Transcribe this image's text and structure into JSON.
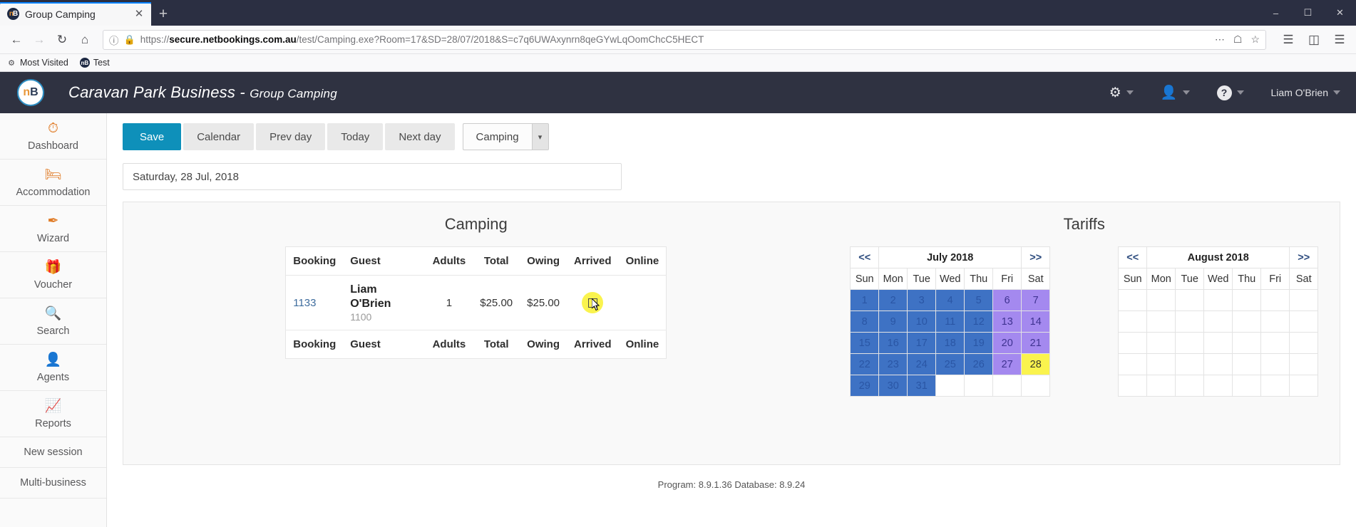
{
  "browser": {
    "tab": {
      "title": "Group Camping",
      "favicon_icon": "netbookings-favicon",
      "close_icon": "close-icon"
    },
    "newtab_icon": "plus-icon",
    "window_controls": {
      "minimize": "–",
      "maximize": "☐",
      "close": "✕"
    },
    "nav": {
      "back_icon": "back-arrow-icon",
      "forward_icon": "forward-arrow-icon",
      "reload_icon": "reload-icon",
      "home_icon": "home-icon",
      "info_icon": "page-info-icon",
      "lock_icon": "lock-icon",
      "url": "https://secure.netbookings.com.au/test/Camping.exe?Room=17&SD=28/07/2018&S=c7q6UWAxynrn8qeGYwLqOomChcC5HECT",
      "url_domain": "secure.netbookings.com.au",
      "url_prefix": "https://",
      "url_suffix": "/test/Camping.exe?Room=17&SD=28/07/2018&S=c7q6UWAxynrn8qeGYwLqOomChcC5HECT",
      "menu_icon": "ellipsis-icon",
      "pocket_icon": "pocket-icon",
      "star_icon": "bookmark-star-icon",
      "library_icon": "library-icon",
      "sidebar_icon": "sidebar-icon",
      "hamburger_icon": "hamburger-menu-icon"
    },
    "bookmarks": [
      {
        "label": "Most Visited",
        "icon": "most-visited-icon"
      },
      {
        "label": "Test",
        "icon": "netbookings-favicon"
      }
    ]
  },
  "header": {
    "logo_text": "nB",
    "title_main": "Caravan Park Business",
    "title_sep": " - ",
    "title_sub": "Group Camping",
    "settings_icon": "gears-icon",
    "user_icon": "person-icon",
    "help_icon": "question-mark-icon",
    "username": "Liam O'Brien"
  },
  "sidebar": {
    "items": [
      {
        "label": "Dashboard",
        "icon": "dashboard-gauge-icon",
        "glyph": "⏱"
      },
      {
        "label": "Accommodation",
        "icon": "bed-icon",
        "glyph": "🛏"
      },
      {
        "label": "Wizard",
        "icon": "magic-wand-icon",
        "glyph": "✒"
      },
      {
        "label": "Voucher",
        "icon": "gift-icon",
        "glyph": "🎁"
      },
      {
        "label": "Search",
        "icon": "magnifier-icon",
        "glyph": "🔍"
      },
      {
        "label": "Agents",
        "icon": "agent-person-icon",
        "glyph": "👤"
      },
      {
        "label": "Reports",
        "icon": "chart-up-icon",
        "glyph": "📈"
      }
    ],
    "plain_items": [
      {
        "label": "New session"
      },
      {
        "label": "Multi-business"
      }
    ]
  },
  "toolbar": {
    "save_label": "Save",
    "calendar_label": "Calendar",
    "prev_day_label": "Prev day",
    "today_label": "Today",
    "next_day_label": "Next day",
    "select_value": "Camping",
    "select_arrow_icon": "chevron-down-icon"
  },
  "date_bar": {
    "value": "Saturday, 28 Jul, 2018"
  },
  "camping_panel": {
    "title": "Camping",
    "columns": [
      "Booking",
      "Guest",
      "Adults",
      "Total",
      "Owing",
      "Arrived",
      "Online"
    ],
    "rows": [
      {
        "booking": "1133",
        "guest_name": "Liam O'Brien",
        "guest_sub": "1100",
        "adults": "1",
        "total": "$25.00",
        "owing": "$25.00",
        "arrived_checked": false,
        "arrived_icon": "checkbox-icon",
        "online": ""
      }
    ]
  },
  "tariffs_panel": {
    "title": "Tariffs"
  },
  "calendars": [
    {
      "name": "july-calendar",
      "prev_label": "<<",
      "next_label": ">>",
      "month_label": "July 2018",
      "dow": [
        "Sun",
        "Mon",
        "Tue",
        "Wed",
        "Thu",
        "Fri",
        "Sat"
      ],
      "weeks": [
        [
          {
            "d": "1",
            "t": "blue"
          },
          {
            "d": "2",
            "t": "blue"
          },
          {
            "d": "3",
            "t": "blue"
          },
          {
            "d": "4",
            "t": "blue"
          },
          {
            "d": "5",
            "t": "blue"
          },
          {
            "d": "6",
            "t": "purple"
          },
          {
            "d": "7",
            "t": "purple"
          }
        ],
        [
          {
            "d": "8",
            "t": "blue"
          },
          {
            "d": "9",
            "t": "blue"
          },
          {
            "d": "10",
            "t": "blue"
          },
          {
            "d": "11",
            "t": "blue"
          },
          {
            "d": "12",
            "t": "blue"
          },
          {
            "d": "13",
            "t": "purple"
          },
          {
            "d": "14",
            "t": "purple"
          }
        ],
        [
          {
            "d": "15",
            "t": "blue"
          },
          {
            "d": "16",
            "t": "blue"
          },
          {
            "d": "17",
            "t": "blue"
          },
          {
            "d": "18",
            "t": "blue"
          },
          {
            "d": "19",
            "t": "blue"
          },
          {
            "d": "20",
            "t": "purple"
          },
          {
            "d": "21",
            "t": "purple"
          }
        ],
        [
          {
            "d": "22",
            "t": "blue"
          },
          {
            "d": "23",
            "t": "blue"
          },
          {
            "d": "24",
            "t": "blue"
          },
          {
            "d": "25",
            "t": "blue"
          },
          {
            "d": "26",
            "t": "blue"
          },
          {
            "d": "27",
            "t": "purple"
          },
          {
            "d": "28",
            "t": "today"
          }
        ],
        [
          {
            "d": "29",
            "t": "blue"
          },
          {
            "d": "30",
            "t": "blue"
          },
          {
            "d": "31",
            "t": "blue"
          },
          {
            "d": "",
            "t": "empty"
          },
          {
            "d": "",
            "t": "empty"
          },
          {
            "d": "",
            "t": "empty"
          },
          {
            "d": "",
            "t": "empty"
          }
        ]
      ]
    },
    {
      "name": "august-calendar",
      "prev_label": "<<",
      "next_label": ">>",
      "month_label": "August 2018",
      "dow": [
        "Sun",
        "Mon",
        "Tue",
        "Wed",
        "Thu",
        "Fri",
        "Sat"
      ],
      "weeks": [
        [
          {
            "d": "",
            "t": "empty"
          },
          {
            "d": "",
            "t": "empty"
          },
          {
            "d": "",
            "t": "empty"
          },
          {
            "d": "",
            "t": "empty"
          },
          {
            "d": "",
            "t": "empty"
          },
          {
            "d": "",
            "t": "empty"
          },
          {
            "d": "",
            "t": "empty"
          }
        ],
        [
          {
            "d": "",
            "t": "empty"
          },
          {
            "d": "",
            "t": "empty"
          },
          {
            "d": "",
            "t": "empty"
          },
          {
            "d": "",
            "t": "empty"
          },
          {
            "d": "",
            "t": "empty"
          },
          {
            "d": "",
            "t": "empty"
          },
          {
            "d": "",
            "t": "empty"
          }
        ],
        [
          {
            "d": "",
            "t": "empty"
          },
          {
            "d": "",
            "t": "empty"
          },
          {
            "d": "",
            "t": "empty"
          },
          {
            "d": "",
            "t": "empty"
          },
          {
            "d": "",
            "t": "empty"
          },
          {
            "d": "",
            "t": "empty"
          },
          {
            "d": "",
            "t": "empty"
          }
        ],
        [
          {
            "d": "",
            "t": "empty"
          },
          {
            "d": "",
            "t": "empty"
          },
          {
            "d": "",
            "t": "empty"
          },
          {
            "d": "",
            "t": "empty"
          },
          {
            "d": "",
            "t": "empty"
          },
          {
            "d": "",
            "t": "empty"
          },
          {
            "d": "",
            "t": "empty"
          }
        ],
        [
          {
            "d": "",
            "t": "empty"
          },
          {
            "d": "",
            "t": "empty"
          },
          {
            "d": "",
            "t": "empty"
          },
          {
            "d": "",
            "t": "empty"
          },
          {
            "d": "",
            "t": "empty"
          },
          {
            "d": "",
            "t": "empty"
          },
          {
            "d": "",
            "t": "empty"
          }
        ]
      ]
    }
  ],
  "footer": {
    "text": "Program: 8.9.1.36 Database: 8.9.24"
  },
  "colors": {
    "accent_blue": "#0e90ba",
    "header_dark": "#2f3241",
    "sidebar_orange": "#e07b26",
    "owing_red": "#d0232b",
    "cal_blue": "#3e72c4",
    "cal_purple": "#a489ef",
    "cal_today": "#faf34e"
  }
}
